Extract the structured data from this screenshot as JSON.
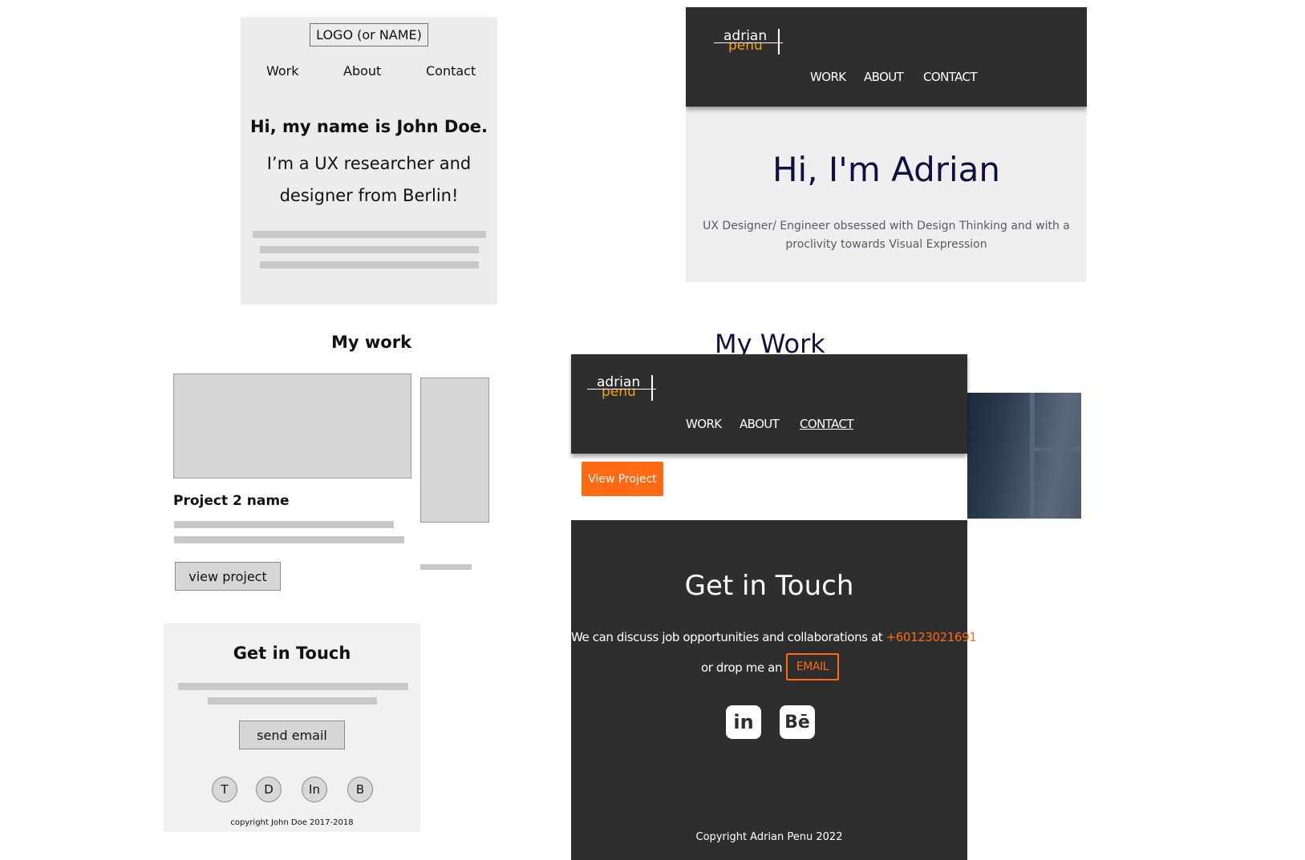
{
  "wireframe": {
    "logo": "LOGO (or NAME)",
    "nav": [
      "Work",
      "About",
      "Contact"
    ],
    "greeting": "Hi, my name is John Doe.",
    "intro_line1": "I’m a UX researcher and",
    "intro_line2": "designer from Berlin!",
    "my_work": "My work",
    "project_name": "Project 2 name",
    "view_project": "view project",
    "get_in_touch": "Get in Touch",
    "send_email": "send email",
    "social": [
      "T",
      "D",
      "In",
      "B"
    ],
    "copyright": "copyright John Doe 2017-2018"
  },
  "design": {
    "logo_top": "adrian",
    "logo_bottom": "penu",
    "nav": [
      "WORK",
      "ABOUT",
      "CONTACT"
    ],
    "greeting": "Hi, I'm Adrian",
    "subtitle_line1": "UX Designer/ Engineer obsessed with Design Thinking and with a",
    "subtitle_line2": "proclivity towards Visual Expression",
    "my_work": "My Work",
    "view_project": "View Project",
    "get_in_touch": "Get in Touch",
    "contact_text": "We can discuss job opportunities and collaborations at ",
    "phone": "+60123021691",
    "drop_text": "or drop me an",
    "email_label": "EMAIL",
    "linkedin_icon": "in",
    "behance_icon": "Bē",
    "copyright": "Copyright Adrian Penu 2022"
  },
  "colors": {
    "accent": "#ff6a13",
    "logo_accent": "#f5a00f",
    "dark": "#2e2e2e",
    "navy": "#101040"
  }
}
